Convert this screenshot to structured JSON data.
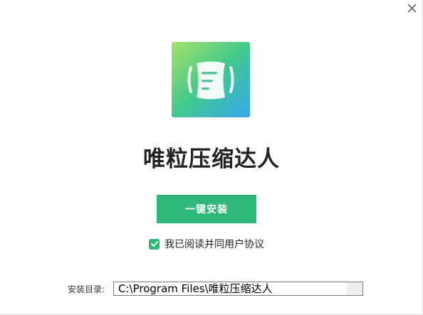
{
  "window": {
    "close_icon": "close-icon"
  },
  "app": {
    "logo_icon": "document-scroll-icon",
    "title": "唯粒压缩达人"
  },
  "install": {
    "button_label": "一键安装"
  },
  "agreement": {
    "checked": true,
    "text": "我已阅读并同用户协议"
  },
  "install_dir": {
    "label": "安装目录:",
    "value": "C:\\Program Files\\唯粒压缩达人"
  },
  "colors": {
    "accent": "#2fb77a",
    "logo_gradient_start": "#9fdf6a",
    "logo_gradient_mid": "#3fc98e",
    "logo_gradient_end": "#3aa8f0"
  }
}
